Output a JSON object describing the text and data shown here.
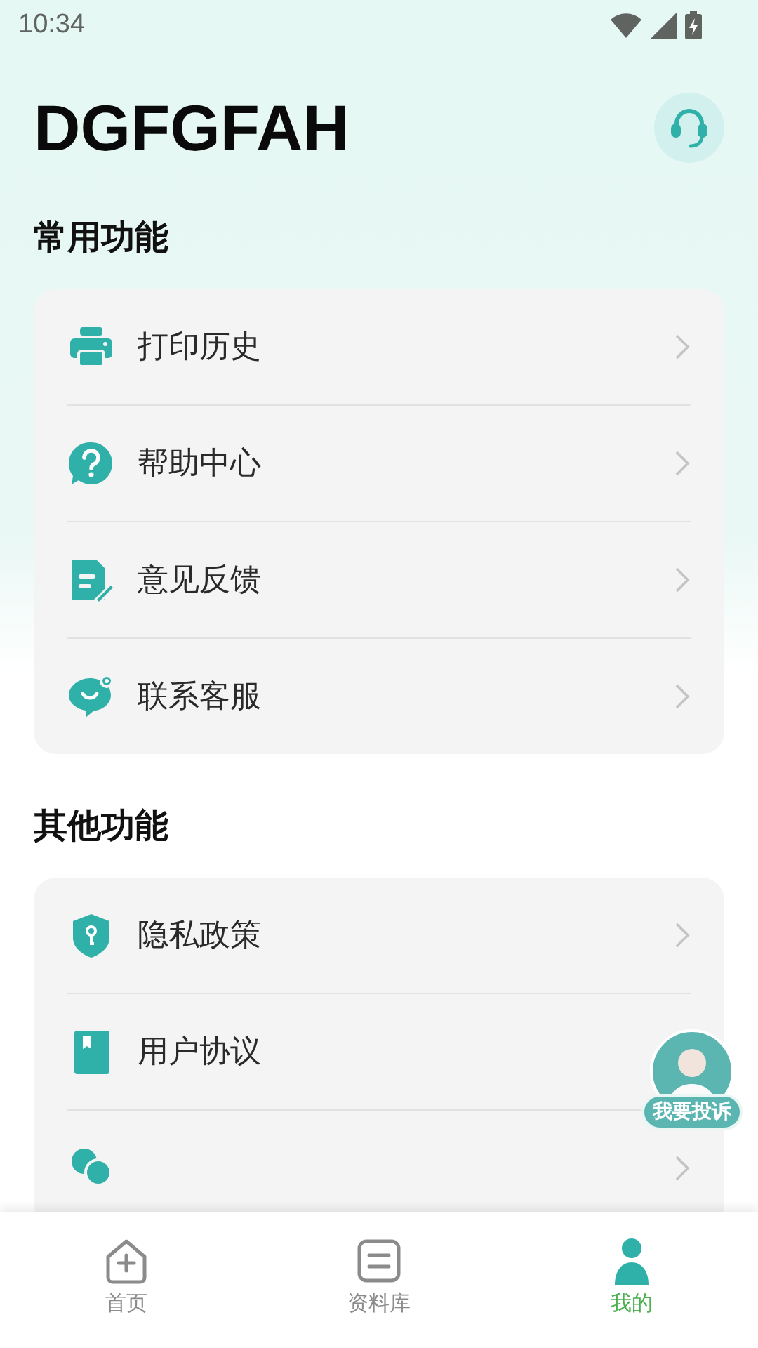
{
  "status_bar": {
    "time": "10:34"
  },
  "header": {
    "title": "DGFGFAH"
  },
  "sections": [
    {
      "title": "常用功能",
      "items": [
        {
          "kind": "link",
          "label": "打印历史"
        },
        {
          "kind": "link",
          "label": "帮助中心"
        },
        {
          "kind": "link",
          "label": "意见反馈"
        },
        {
          "kind": "link",
          "label": "联系客服"
        }
      ]
    },
    {
      "title": "其他功能",
      "items": [
        {
          "kind": "link",
          "label": "隐私政策"
        },
        {
          "kind": "link",
          "label": "用户协议"
        },
        {
          "kind": "cut_off"
        }
      ]
    }
  ],
  "complaint": {
    "label": "我要投诉"
  },
  "nav": [
    {
      "label": "首页",
      "selected": false
    },
    {
      "label": "资料库",
      "selected": false
    },
    {
      "label": "我的",
      "selected": true
    }
  ]
}
